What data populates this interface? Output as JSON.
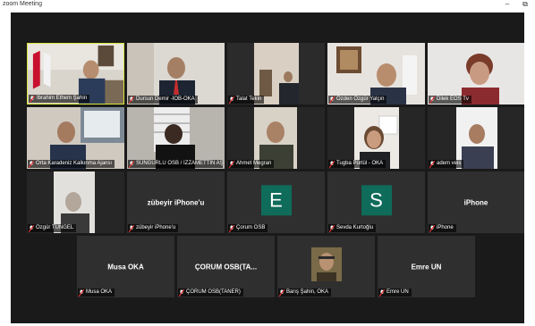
{
  "app": {
    "title": "zoom Meeting",
    "minimize_glyph": "–",
    "restore_glyph": "⧉"
  },
  "colors": {
    "active_speaker_border": "#d8e63a",
    "avatar_bg": "#0f6b5a",
    "muted_icon": "#e0312f"
  },
  "participants": [
    {
      "name": "İbrahim Ethem Şahin",
      "muted": true,
      "video": true,
      "active": true
    },
    {
      "name": "Dursun Demir -İOB-OKA",
      "muted": true,
      "video": true
    },
    {
      "name": "Talat Tekin",
      "muted": true,
      "video": true
    },
    {
      "name": "Özden Özgür Yalçın",
      "muted": true,
      "video": true
    },
    {
      "name": "Dilek EOS Tv",
      "muted": true,
      "video": true
    },
    {
      "name": "Orta Karadeniz Kalkınma Ajansı",
      "muted": true,
      "video": true
    },
    {
      "name": "SUNGURLU OSB / İZZAMETTİN AŞAN",
      "muted": true,
      "video": true
    },
    {
      "name": "Ahmet Megran",
      "muted": true,
      "video": true
    },
    {
      "name": "Tugba Pürtül - OKA",
      "muted": true,
      "video": true
    },
    {
      "name": "adem veis",
      "muted": true,
      "video": true
    },
    {
      "name": "Özgür TÜNGEL",
      "muted": true,
      "video": true
    },
    {
      "name": "zübeyir iPhone'u",
      "display": "zübeyir iPhone'u",
      "muted": true,
      "video": false
    },
    {
      "name": "Çorum OSB",
      "avatar_letter": "E",
      "muted": true,
      "video": false
    },
    {
      "name": "Sevda Kurtoğlu",
      "avatar_letter": "S",
      "muted": true,
      "video": false
    },
    {
      "name": "iPhone",
      "display": "iPhone",
      "muted": true,
      "video": false
    },
    {
      "name": "Musa OKA",
      "display": "Musa OKA",
      "muted": true,
      "video": false
    },
    {
      "name": "ÇORUM OSB(TANER)",
      "display": "ÇORUM OSB(TA...",
      "muted": true,
      "video": false
    },
    {
      "name": "Barış Şahin, OKA",
      "muted": true,
      "video": false,
      "photo": true
    },
    {
      "name": "Emre UN",
      "display": "Emre UN",
      "muted": true,
      "video": false
    }
  ]
}
